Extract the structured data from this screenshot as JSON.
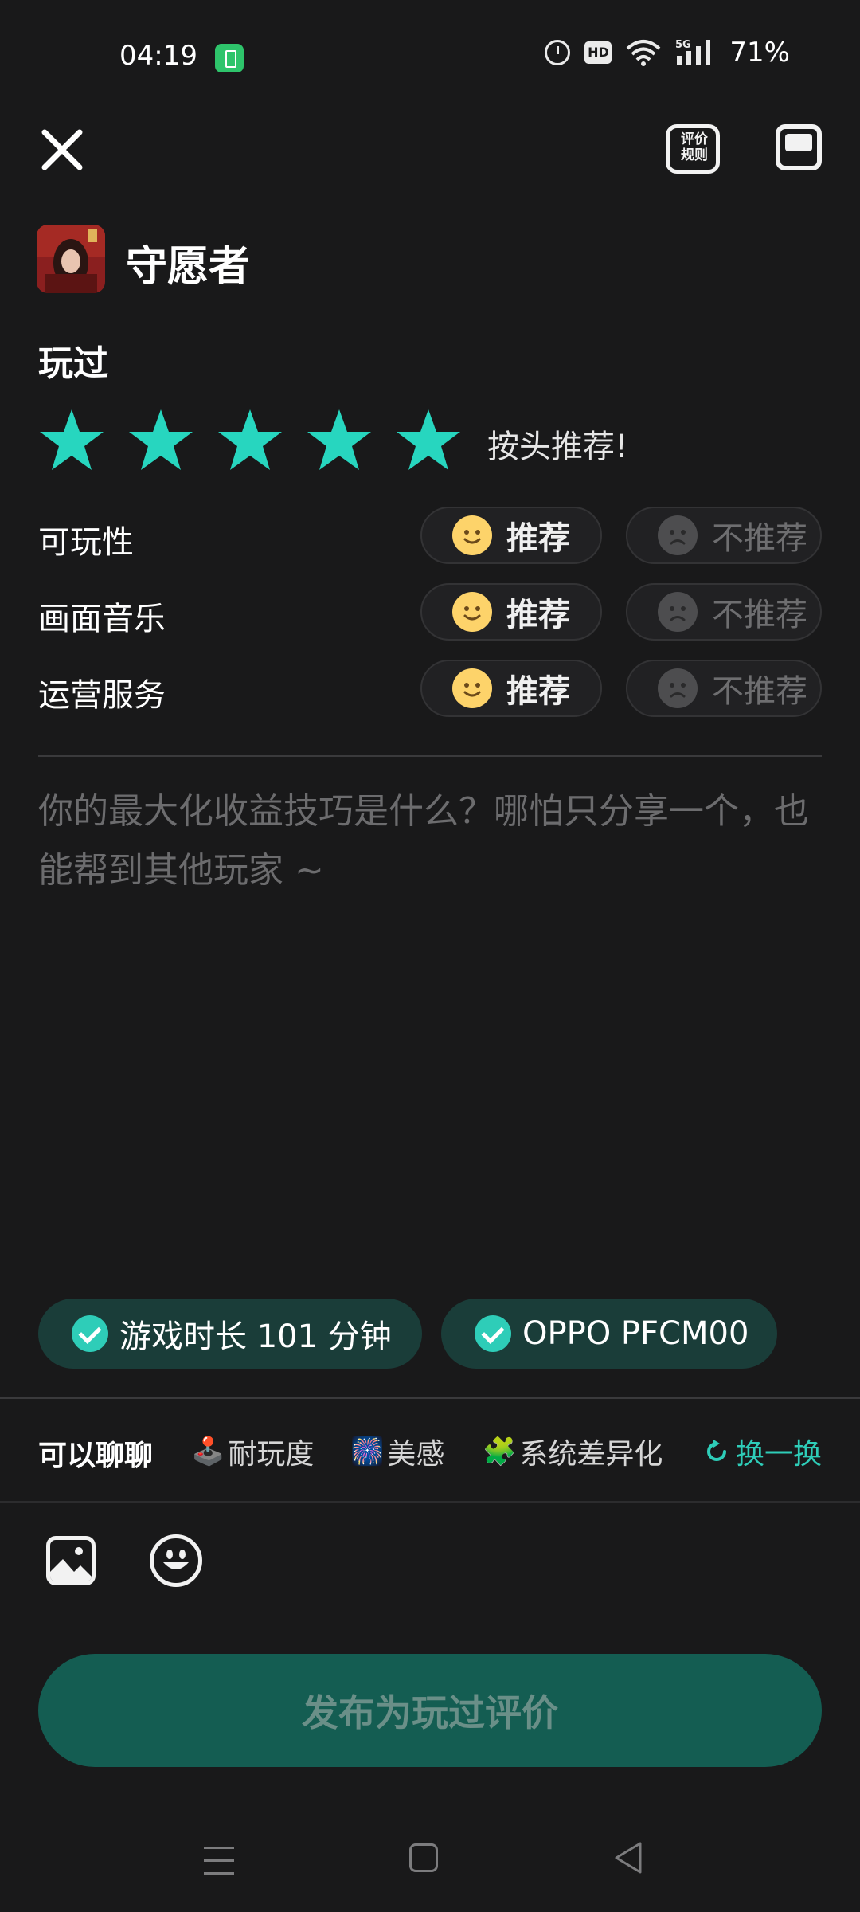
{
  "status_bar": {
    "time": "04:19",
    "battery": "71%",
    "hd_label": "HD",
    "network_label": "5G"
  },
  "header": {
    "rules_label_line1": "评价",
    "rules_label_line2": "规则"
  },
  "game": {
    "title": "守愿者"
  },
  "played_label": "玩过",
  "rating": {
    "stars": 5,
    "max_stars": 5,
    "text": "按头推荐!",
    "star_color": "#27d6bf"
  },
  "criteria": [
    {
      "label": "可玩性",
      "recommend": "推荐",
      "not_recommend": "不推荐",
      "selected": "recommend"
    },
    {
      "label": "画面音乐",
      "recommend": "推荐",
      "not_recommend": "不推荐",
      "selected": "recommend"
    },
    {
      "label": "运营服务",
      "recommend": "推荐",
      "not_recommend": "不推荐",
      "selected": "recommend"
    }
  ],
  "review": {
    "placeholder": "你的最大化收益技巧是什么？哪怕只分享一个，也能帮到其他玩家 ~",
    "value": ""
  },
  "tags": [
    {
      "text": "游戏时长 101 分钟"
    },
    {
      "text": "OPPO PFCM00"
    }
  ],
  "topics": {
    "heading": "可以聊聊",
    "items": [
      {
        "icon": "joystick-icon",
        "emoji": "🕹️",
        "label": "耐玩度"
      },
      {
        "icon": "fireworks-icon",
        "emoji": "🎆",
        "label": "美感"
      },
      {
        "icon": "puzzle-icon",
        "emoji": "🧩",
        "label": "系统差异化"
      }
    ],
    "shuffle_label": "换一换"
  },
  "publish_label": "发布为玩过评价",
  "colors": {
    "accent": "#2ecdb8",
    "background": "#19191a",
    "publish_bg": "#145d52",
    "tag_bg": "#1a3d39"
  }
}
